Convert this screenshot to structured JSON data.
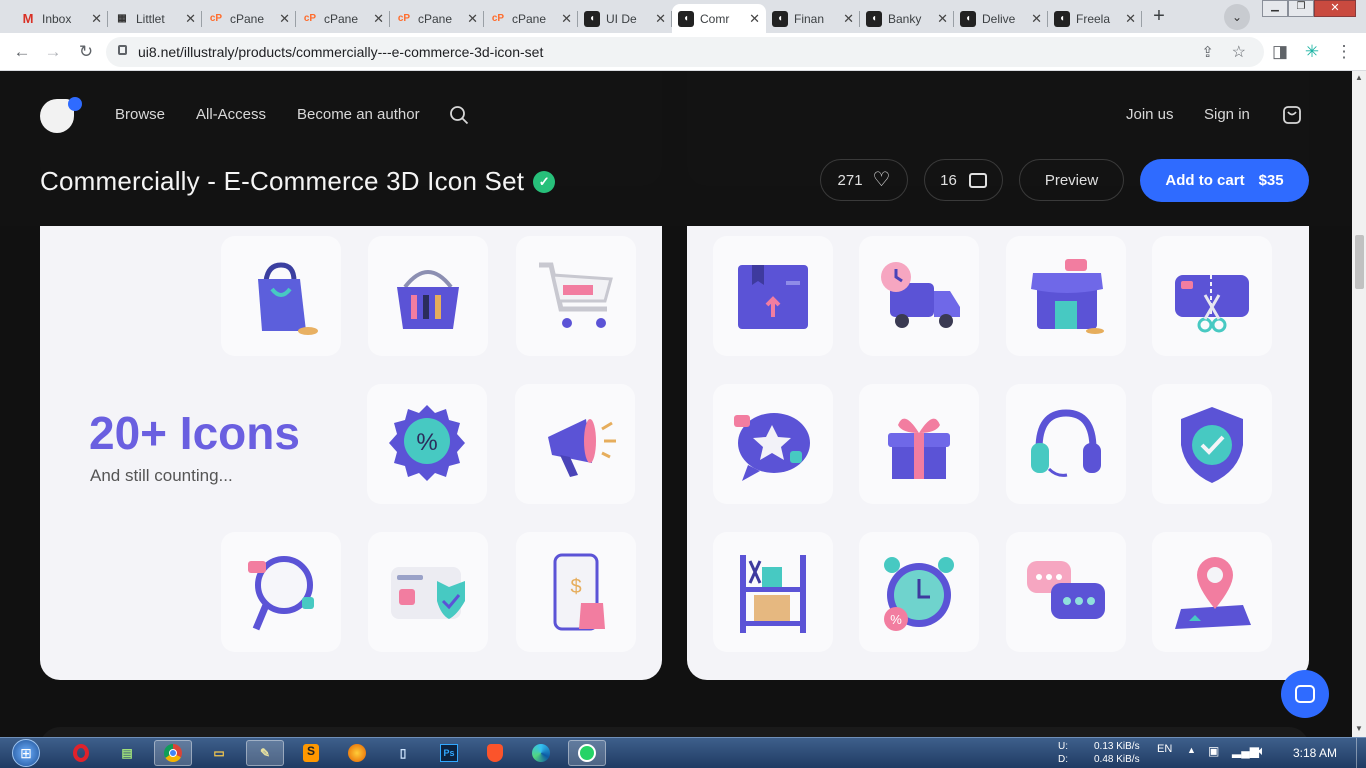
{
  "browser": {
    "tabs": [
      {
        "label": "Inbox",
        "icon": "gmail-icon",
        "icon_text": "M",
        "icon_color": "#d93025"
      },
      {
        "label": "Littlet",
        "icon": "littlet-icon",
        "icon_text": "▦",
        "icon_color": "#333"
      },
      {
        "label": "cPane",
        "icon": "cpanel-icon",
        "icon_text": "cP",
        "icon_color": "#ff6c2c"
      },
      {
        "label": "cPane",
        "icon": "cpanel-icon",
        "icon_text": "cP",
        "icon_color": "#ff6c2c"
      },
      {
        "label": "cPane",
        "icon": "cpanel-icon",
        "icon_text": "cP",
        "icon_color": "#ff6c2c"
      },
      {
        "label": "cPane",
        "icon": "cpanel-icon",
        "icon_text": "cP",
        "icon_color": "#ff6c2c"
      },
      {
        "label": "UI De",
        "icon": "ui8-icon",
        "icon_text": "◖",
        "icon_color": "#222"
      },
      {
        "label": "Comr",
        "icon": "ui8-icon",
        "icon_text": "◖",
        "icon_color": "#222"
      },
      {
        "label": "Finan",
        "icon": "ui8-icon",
        "icon_text": "◖",
        "icon_color": "#222"
      },
      {
        "label": "Banky",
        "icon": "ui8-icon",
        "icon_text": "◖",
        "icon_color": "#222"
      },
      {
        "label": "Delive",
        "icon": "ui8-icon",
        "icon_text": "◖",
        "icon_color": "#222"
      },
      {
        "label": "Freela",
        "icon": "ui8-icon",
        "icon_text": "◖",
        "icon_color": "#222"
      }
    ],
    "active_tab": 7,
    "url": "ui8.net/illustraly/products/commercially---e-commerce-3d-icon-set"
  },
  "site": {
    "nav": {
      "browse": "Browse",
      "all_access": "All-Access",
      "become_author": "Become an author",
      "join": "Join us",
      "sign_in": "Sign in"
    },
    "product": {
      "title": "Commercially - E-Commerce 3D Icon Set",
      "likes": "271",
      "comments": "16",
      "preview": "Preview",
      "add_to_cart": "Add to cart",
      "price": "$35"
    },
    "promo": {
      "headline": "20+ Icons",
      "subtitle": "And still counting..."
    },
    "colors": {
      "accent": "#2f6bff",
      "verified": "#27c07a",
      "headline": "#6a5fe0"
    }
  },
  "taskbar": {
    "net_up": "0.13 KiB/s",
    "net_down": "0.48 KiB/s",
    "net_up_label": "U:",
    "net_down_label": "D:",
    "lang": "EN",
    "time": "3:18 AM"
  }
}
